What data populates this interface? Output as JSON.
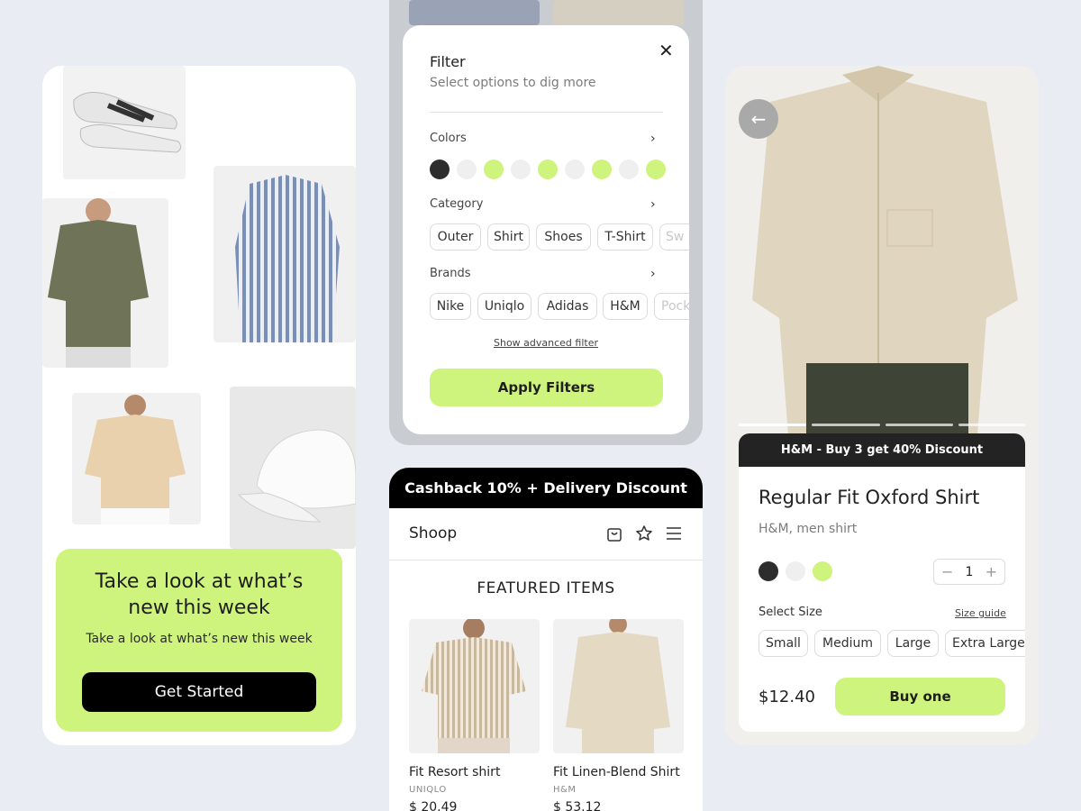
{
  "left_card": {
    "promo_title": "Take a look at what’s new this week",
    "promo_subtitle": "Take a look at what’s new this week",
    "cta_label": "Get Started"
  },
  "filter": {
    "title": "Filter",
    "subtitle": "Select options to dig more",
    "close_icon": "close-icon",
    "colors_label": "Colors",
    "colors": [
      "#2d2d2d",
      "#efefef",
      "#cff47d",
      "#efefef",
      "#cff47d",
      "#efefef",
      "#cff47d",
      "#efefef",
      "#cff47d"
    ],
    "category_label": "Category",
    "categories": [
      "Outer",
      "Shirt",
      "Shoes",
      "T-Shirt",
      "Sw"
    ],
    "brands_label": "Brands",
    "brands": [
      "Nike",
      "Uniqlo",
      "Adidas",
      "H&M",
      "Pock"
    ],
    "advanced_link": "Show advanced filter",
    "apply_label": "Apply Filters"
  },
  "shop": {
    "banner": "Cashback 10% + Delivery Discount",
    "title": "Shoop",
    "section_title": "FEATURED ITEMS",
    "products": [
      {
        "name": "Fit Resort shirt",
        "brand": "UNIQLO",
        "price": "$ 20.49"
      },
      {
        "name": "Fit Linen-Blend Shirt",
        "brand": "H&M",
        "price": "$ 53.12"
      }
    ]
  },
  "detail": {
    "promo": "H&M - Buy 3 get 40% Discount",
    "title": "Regular Fit Oxford Shirt",
    "subtitle": "H&M, men shirt",
    "colors": [
      "#2d2d2d",
      "#efefef",
      "#cff47d"
    ],
    "quantity": "1",
    "size_label": "Select Size",
    "size_guide": "Size guide",
    "sizes": [
      "Small",
      "Medium",
      "Large",
      "Extra Large"
    ],
    "price": "$12.40",
    "buy_label": "Buy one"
  },
  "accent_color": "#cff47d"
}
